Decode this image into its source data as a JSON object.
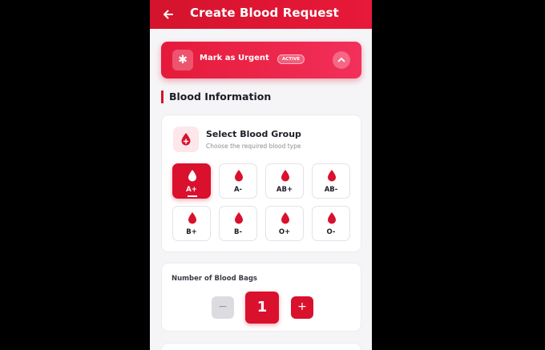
{
  "header": {
    "title": "Create Blood Request"
  },
  "urgent": {
    "label": "Mark as Urgent",
    "badge": "ACTIVE"
  },
  "section": {
    "heading": "Blood Information"
  },
  "blood_group": {
    "title": "Select Blood Group",
    "subtitle": "Choose the required blood type",
    "options": [
      "A+",
      "A-",
      "AB+",
      "AB-",
      "B+",
      "B-",
      "O+",
      "O-"
    ],
    "selected": "A+"
  },
  "bags": {
    "label": "Number of Blood Bags",
    "count": "1",
    "minus": "−",
    "plus": "+"
  },
  "colors": {
    "accent": "#d9112d",
    "header": "#e01733",
    "background": "#f5f5f7"
  },
  "icons": {
    "back": "arrow-left-icon",
    "urgent": "asterisk-icon",
    "collapse": "chevron-up-icon",
    "drop": "blood-drop-icon"
  }
}
